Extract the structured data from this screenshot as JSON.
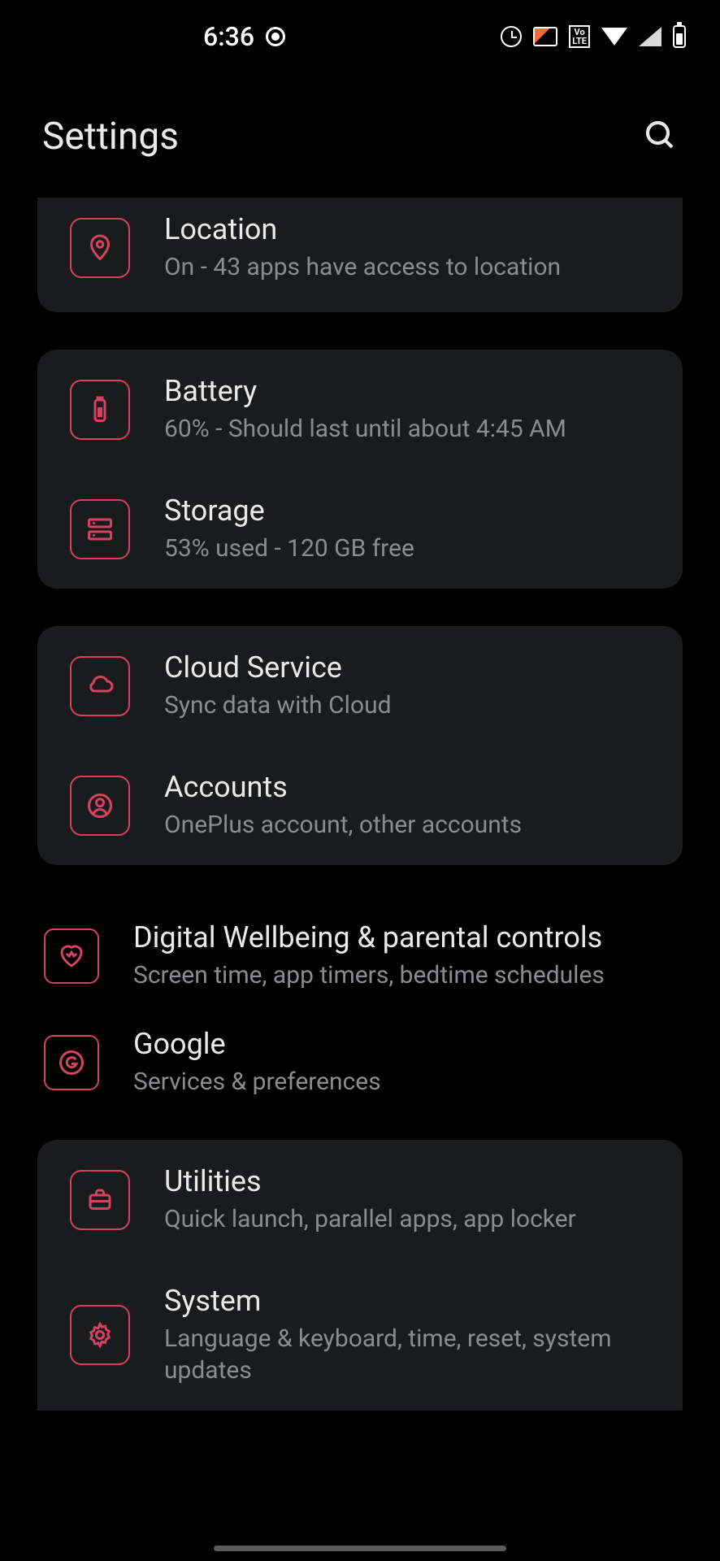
{
  "statusbar": {
    "time": "6:36",
    "lte": "Vo\nLTE"
  },
  "header": {
    "title": "Settings"
  },
  "groups": [
    {
      "card": true,
      "cutTop": true,
      "items": [
        {
          "id": "location",
          "icon": "pin",
          "title": "Location",
          "sub": "On - 43 apps have access to location"
        }
      ]
    },
    {
      "card": true,
      "items": [
        {
          "id": "battery",
          "icon": "battery",
          "title": "Battery",
          "sub": "60% - Should last until about 4:45 AM"
        },
        {
          "id": "storage",
          "icon": "storage",
          "title": "Storage",
          "sub": "53% used - 120 GB free"
        }
      ]
    },
    {
      "card": true,
      "items": [
        {
          "id": "cloud",
          "icon": "cloud",
          "title": "Cloud Service",
          "sub": "Sync data with Cloud"
        },
        {
          "id": "accounts",
          "icon": "person",
          "title": "Accounts",
          "sub": "OnePlus account, other accounts"
        }
      ]
    },
    {
      "card": false,
      "items": [
        {
          "id": "wellbeing",
          "icon": "heart",
          "title": "Digital Wellbeing & parental controls",
          "sub": "Screen time, app timers, bedtime schedules"
        },
        {
          "id": "google",
          "icon": "google",
          "title": "Google",
          "sub": "Services & preferences"
        }
      ]
    },
    {
      "card": true,
      "cutBottom": true,
      "items": [
        {
          "id": "utilities",
          "icon": "briefcase",
          "title": "Utilities",
          "sub": "Quick launch, parallel apps, app locker"
        },
        {
          "id": "system",
          "icon": "gear",
          "title": "System",
          "sub": "Language & keyboard, time, reset, system updates"
        }
      ]
    }
  ]
}
